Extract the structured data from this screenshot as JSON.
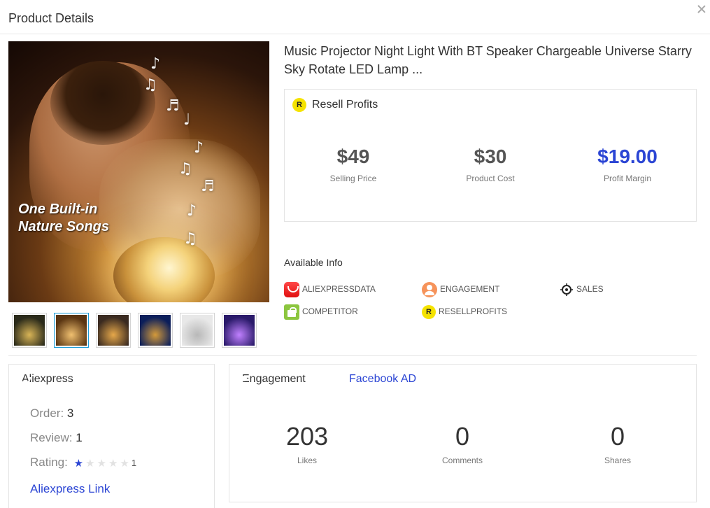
{
  "header": {
    "title": "Product Details"
  },
  "product": {
    "title": "Music Projector Night Light With BT Speaker Chargeable Universe Starry Sky Rotate LED Lamp ...",
    "image_caption": [
      "One Built-in",
      "Nature Songs"
    ],
    "thumbnails": [
      {
        "name": "thumbnail-1",
        "active": false,
        "colors": [
          "#2a2a1a",
          "#d8b456"
        ]
      },
      {
        "name": "thumbnail-2",
        "active": true,
        "colors": [
          "#5a3512",
          "#f0c070"
        ]
      },
      {
        "name": "thumbnail-3",
        "active": false,
        "colors": [
          "#3a2a20",
          "#e6a84a"
        ]
      },
      {
        "name": "thumbnail-4",
        "active": false,
        "colors": [
          "#0b1e5a",
          "#d49a3a"
        ]
      },
      {
        "name": "thumbnail-5",
        "active": false,
        "colors": [
          "#e8e8e8",
          "#b8b8b8"
        ]
      },
      {
        "name": "thumbnail-6",
        "active": false,
        "colors": [
          "#2a1a6a",
          "#c080ff"
        ]
      }
    ]
  },
  "resell": {
    "badge": "R",
    "title": "Resell Profits",
    "selling_price": "$49",
    "selling_price_label": "Selling Price",
    "product_cost": "$30",
    "product_cost_label": "Product Cost",
    "profit_margin": "$19.00",
    "profit_margin_label": "Profit Margin"
  },
  "available_info": {
    "title": "Available Info",
    "items": [
      "ALIEXPRESSDATA",
      "ENGAGEMENT",
      "SALES",
      "COMPETITOR",
      "RESELLPROFITS"
    ]
  },
  "aliexpress": {
    "title": "Aliexpress",
    "order_label": "Order:",
    "order_value": "3",
    "review_label": "Review:",
    "review_value": "1",
    "rating_label": "Rating:",
    "rating_value": "1",
    "rating_stars_filled": 1,
    "rating_stars_total": 5,
    "link": "Aliexpress Link"
  },
  "engagement": {
    "title": "Engagement",
    "tab": "Facebook AD",
    "likes": "203",
    "likes_label": "Likes",
    "comments": "0",
    "comments_label": "Comments",
    "shares": "0",
    "shares_label": "Shares"
  },
  "colors": {
    "accent_blue": "#2b45d4",
    "badge_yellow": "#f5e300",
    "aliexpress_red": "#e01010",
    "engagement_orange": "#f6935a",
    "competitor_green": "#8cc63f"
  }
}
